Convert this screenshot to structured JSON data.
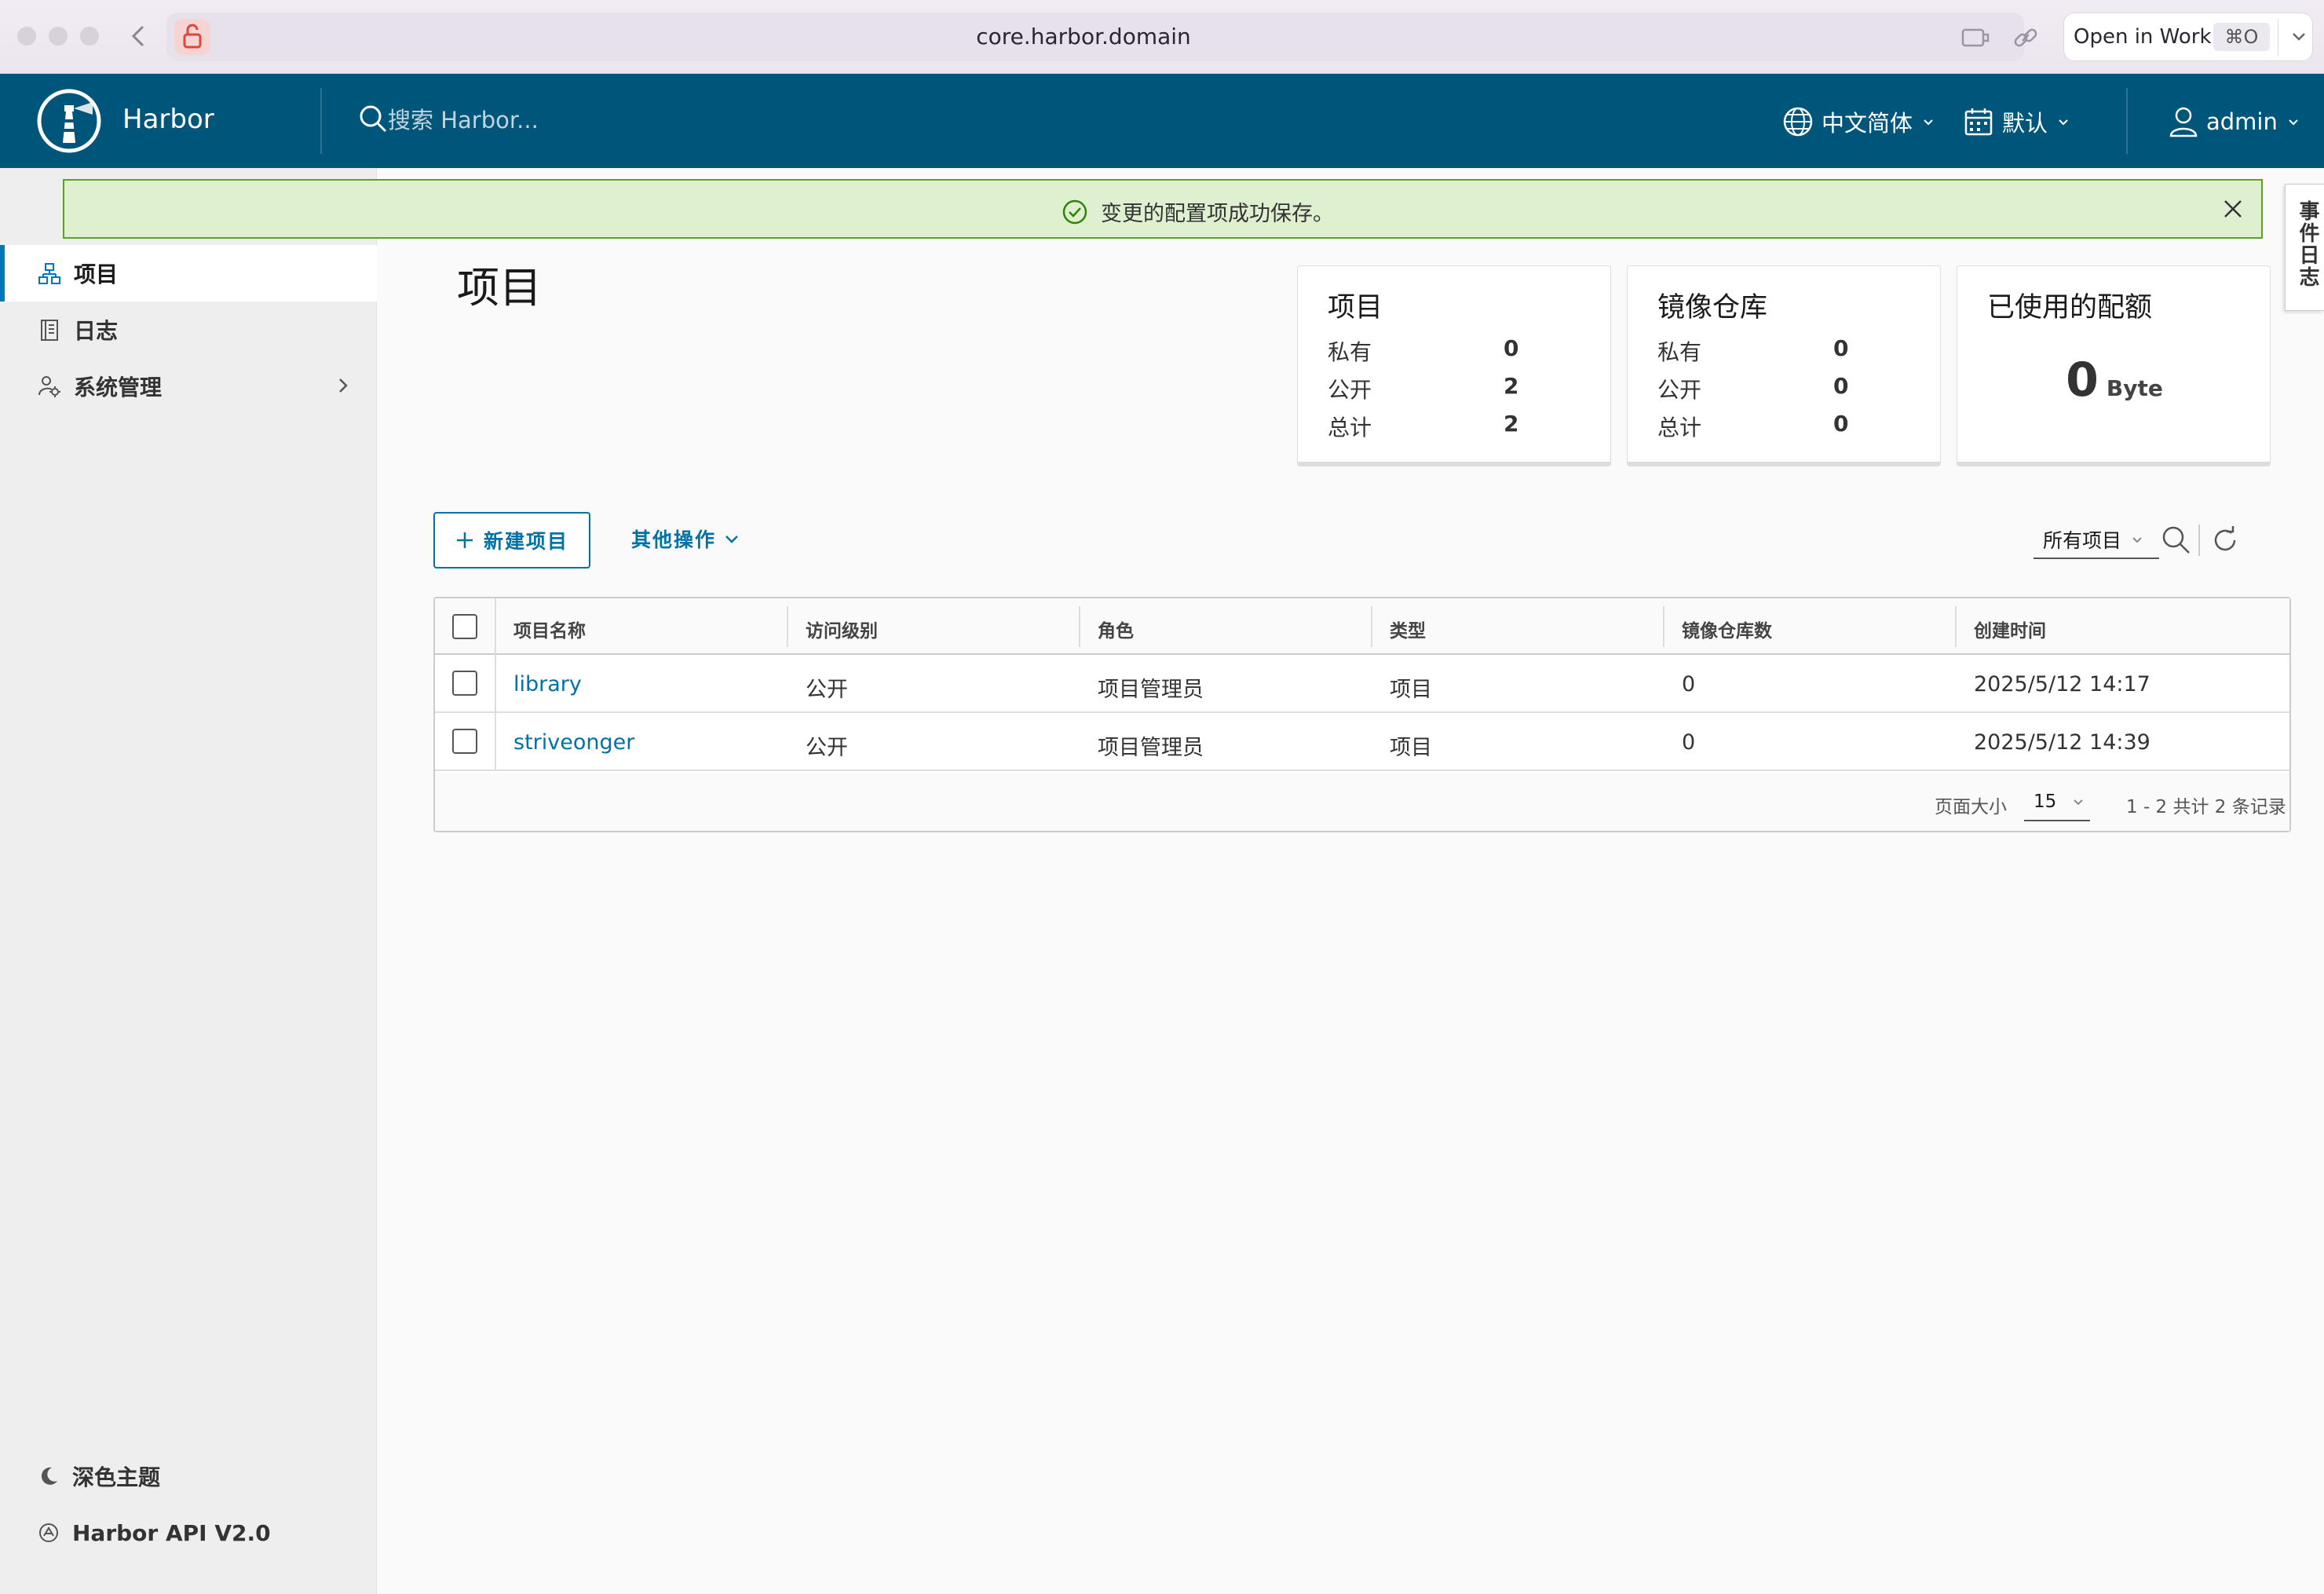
{
  "browser": {
    "url": "core.harbor.domain",
    "open_in_work": "Open in Work",
    "shortcut": "⌘O"
  },
  "header": {
    "brand": "Harbor",
    "search_placeholder": "搜索 Harbor...",
    "language": "中文简体",
    "datetime_format": "默认",
    "user": "admin",
    "accent_color": "#00567a"
  },
  "sidebar": {
    "items": [
      {
        "label": "项目",
        "icon": "projects-icon",
        "active": true
      },
      {
        "label": "日志",
        "icon": "logs-icon",
        "active": false
      },
      {
        "label": "系统管理",
        "icon": "admin-gear-icon",
        "active": false
      }
    ],
    "dark_theme": "深色主题",
    "api": "Harbor API V2.0"
  },
  "alert": {
    "message": "变更的配置项成功保存。",
    "status": "success"
  },
  "event_log_tab": "事件日志",
  "main": {
    "title": "项目",
    "cards": {
      "projects": {
        "title": "项目",
        "rows": [
          {
            "label": "私有",
            "value": "0"
          },
          {
            "label": "公开",
            "value": "2"
          },
          {
            "label": "总计",
            "value": "2"
          }
        ]
      },
      "repos": {
        "title": "镜像仓库",
        "rows": [
          {
            "label": "私有",
            "value": "0"
          },
          {
            "label": "公开",
            "value": "0"
          },
          {
            "label": "总计",
            "value": "0"
          }
        ]
      },
      "quota": {
        "title": "已使用的配额",
        "value": "0",
        "unit": "Byte"
      }
    },
    "toolbar": {
      "new_project": "新建项目",
      "other_actions": "其他操作",
      "filter": "所有项目"
    },
    "table": {
      "columns": [
        "项目名称",
        "访问级别",
        "角色",
        "类型",
        "镜像仓库数",
        "创建时间"
      ],
      "rows": [
        {
          "name": "library",
          "access": "公开",
          "role": "项目管理员",
          "type": "项目",
          "repo_count": "0",
          "created": "2025/5/12 14:17"
        },
        {
          "name": "striveonger",
          "access": "公开",
          "role": "项目管理员",
          "type": "项目",
          "repo_count": "0",
          "created": "2025/5/12 14:39"
        }
      ],
      "footer": {
        "page_size_label": "页面大小",
        "page_size": "15",
        "info": "1 - 2 共计 2 条记录"
      }
    }
  }
}
